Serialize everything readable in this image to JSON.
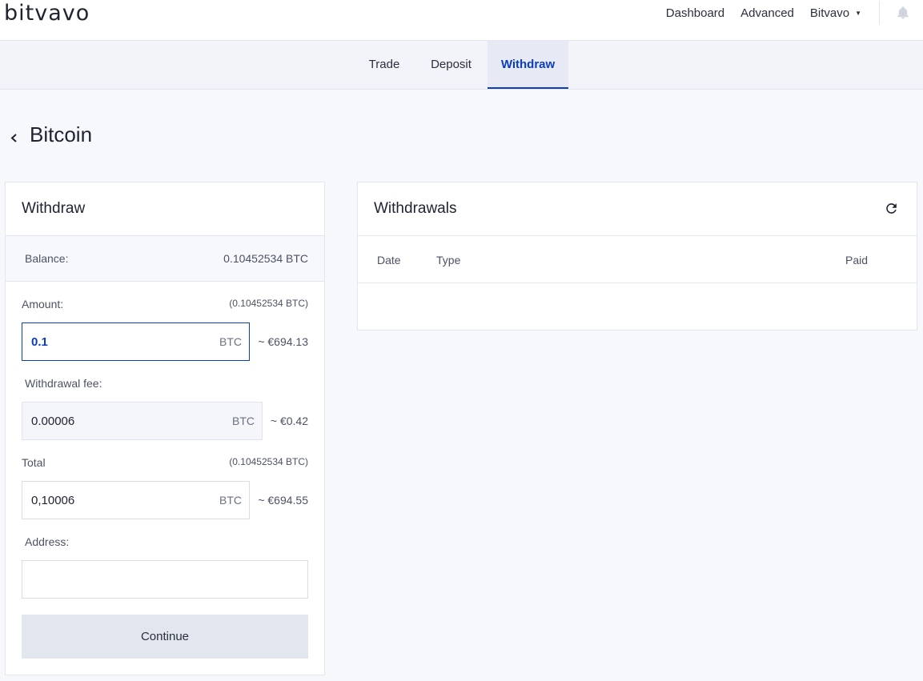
{
  "brand": {
    "logo": "bitvavo"
  },
  "topnav": {
    "dashboard": "Dashboard",
    "advanced": "Advanced",
    "account": "Bitvavo"
  },
  "tabs": {
    "trade": "Trade",
    "deposit": "Deposit",
    "withdraw": "Withdraw",
    "active": "withdraw"
  },
  "page": {
    "title": "Bitcoin"
  },
  "withdraw_form": {
    "title": "Withdraw",
    "balance_label": "Balance:",
    "balance_value": "0.10452534 BTC",
    "amount_label": "Amount:",
    "amount_hint": "(0.10452534 BTC)",
    "amount_value": "0.1",
    "amount_unit": "BTC",
    "amount_approx": "~ €694.13",
    "fee_label": "Withdrawal fee:",
    "fee_value": "0.00006",
    "fee_unit": "BTC",
    "fee_approx": "~ €0.42",
    "total_label": "Total",
    "total_hint": "(0.10452534 BTC)",
    "total_value": "0,10006",
    "total_unit": "BTC",
    "total_approx": "~ €694.55",
    "address_label": "Address:",
    "address_value": "",
    "continue_label": "Continue"
  },
  "withdrawals": {
    "title": "Withdrawals",
    "columns": [
      "Date",
      "Type",
      "Paid"
    ],
    "rows": []
  },
  "colors": {
    "accent": "#0a3dbf",
    "background": "#f7f8fc",
    "button_disabled": "#e2e6ee"
  },
  "icons": [
    "chevron-left-icon",
    "bell-icon",
    "refresh-icon",
    "caret-down-icon"
  ]
}
